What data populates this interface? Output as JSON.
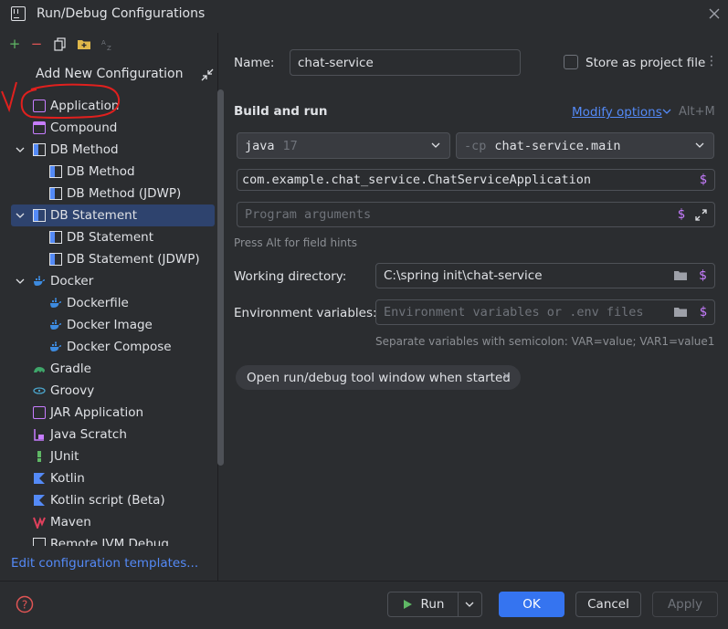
{
  "window": {
    "title": "Run/Debug Configurations"
  },
  "toolbar": {
    "icons": [
      "add-icon",
      "remove-icon",
      "copy-icon",
      "folder-add-icon",
      "sort-icon"
    ]
  },
  "left": {
    "header": "Add New Configuration",
    "items": [
      {
        "label": "Application"
      },
      {
        "label": "Compound"
      },
      {
        "label": "DB Method"
      },
      {
        "label": "DB Method"
      },
      {
        "label": "DB Method (JDWP)"
      },
      {
        "label": "DB Statement"
      },
      {
        "label": "DB Statement"
      },
      {
        "label": "DB Statement (JDWP)"
      },
      {
        "label": "Docker"
      },
      {
        "label": "Dockerfile"
      },
      {
        "label": "Docker Image"
      },
      {
        "label": "Docker Compose"
      },
      {
        "label": "Gradle"
      },
      {
        "label": "Groovy"
      },
      {
        "label": "JAR Application"
      },
      {
        "label": "Java Scratch"
      },
      {
        "label": "JUnit"
      },
      {
        "label": "Kotlin"
      },
      {
        "label": "Kotlin script (Beta)"
      },
      {
        "label": "Maven"
      },
      {
        "label": "Remote JVM Debug"
      }
    ],
    "edit_templates": "Edit configuration templates..."
  },
  "form": {
    "name_label": "Name:",
    "name_value": "chat-service",
    "store_label": "Store as project file",
    "section_title": "Build and run",
    "modify_options": "Modify options",
    "modify_shortcut": "Alt+M",
    "jdk_name": "java",
    "jdk_version": "17",
    "cp_flag": "-cp",
    "cp_value": "chat-service.main",
    "main_class": "com.example.chat_service.ChatServiceApplication",
    "program_args_placeholder": "Program arguments",
    "field_hint": "Press Alt for field hints",
    "workdir_label": "Working directory:",
    "workdir_value": "C:\\spring init\\chat-service",
    "env_label": "Environment variables:",
    "env_placeholder": "Environment variables or .env files",
    "env_hint": "Separate variables with semicolon: VAR=value; VAR1=value1",
    "chip_label": "Open run/debug tool window when started",
    "dollar": "$"
  },
  "footer": {
    "run_label": "Run",
    "ok_label": "OK",
    "cancel_label": "Cancel",
    "apply_label": "Apply"
  },
  "colors": {
    "background": "#2b2d30",
    "accent": "#3574f0",
    "link": "#548af7",
    "selection": "#2e436e",
    "annotation": "#e0201e"
  }
}
